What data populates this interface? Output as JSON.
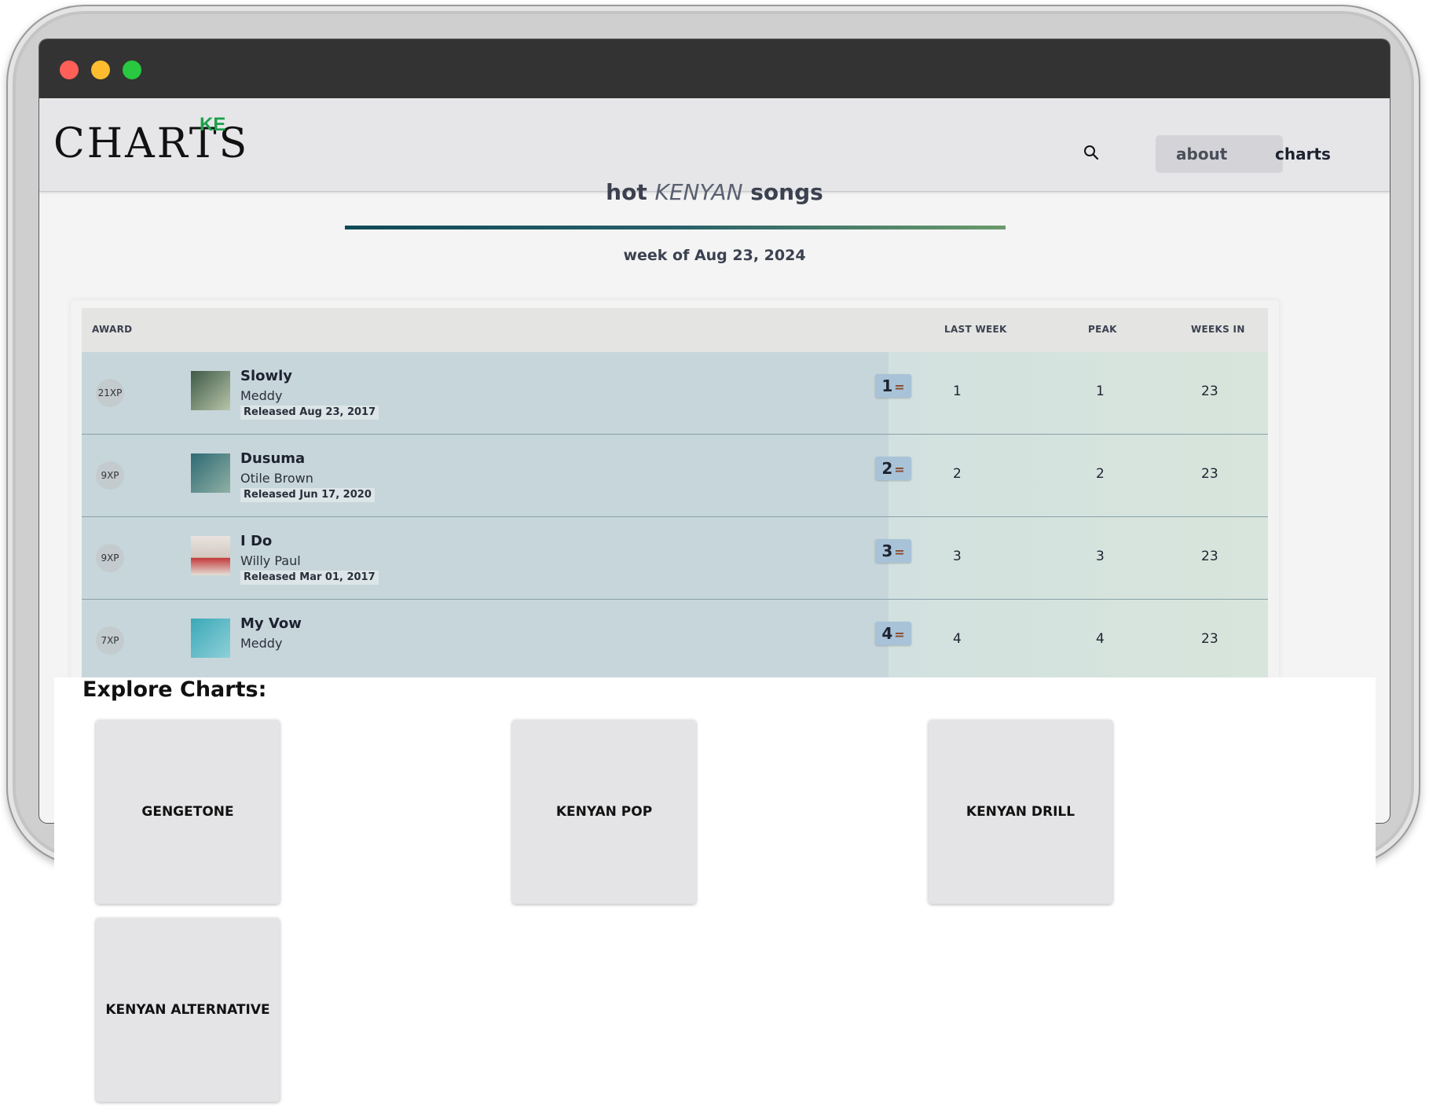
{
  "nav": {
    "logo_text": "CHARTS",
    "logo_suffix": "KE",
    "about_label": "about",
    "charts_label": "charts"
  },
  "header": {
    "title_prefix": "hot",
    "title_emphasis": "KENYAN",
    "title_suffix": "songs",
    "week": "week of Aug 23, 2024"
  },
  "table": {
    "columns": {
      "award": "AWARD",
      "last_week": "LAST WEEK",
      "peak": "PEAK",
      "weeks_in": "WEEKS IN"
    },
    "rows": [
      {
        "award": "21XP",
        "title": "Slowly",
        "artist": "Meddy",
        "released": "Released Aug 23, 2017",
        "position": "1",
        "change": "=",
        "last_week": "1",
        "peak": "1",
        "weeks_in": "23"
      },
      {
        "award": "9XP",
        "title": "Dusuma",
        "artist": "Otile Brown",
        "released": "Released Jun 17, 2020",
        "position": "2",
        "change": "=",
        "last_week": "2",
        "peak": "2",
        "weeks_in": "23"
      },
      {
        "award": "9XP",
        "title": "I Do",
        "artist": "Willy Paul",
        "released": "Released Mar 01, 2017",
        "position": "3",
        "change": "=",
        "last_week": "3",
        "peak": "3",
        "weeks_in": "23"
      },
      {
        "award": "7XP",
        "title": "My Vow",
        "artist": "Meddy",
        "released": "",
        "position": "4",
        "change": "=",
        "last_week": "4",
        "peak": "4",
        "weeks_in": "23"
      }
    ]
  },
  "explore": {
    "title": "Explore Charts:",
    "tiles": [
      "GENGETONE",
      "KENYAN POP",
      "KENYAN DRILL",
      "KENYAN ALTERNATIVE"
    ]
  },
  "colors": {
    "accent_green": "#1aa04a",
    "position_badge": "#a8c3d8",
    "row_bg": "#c7d6db"
  }
}
